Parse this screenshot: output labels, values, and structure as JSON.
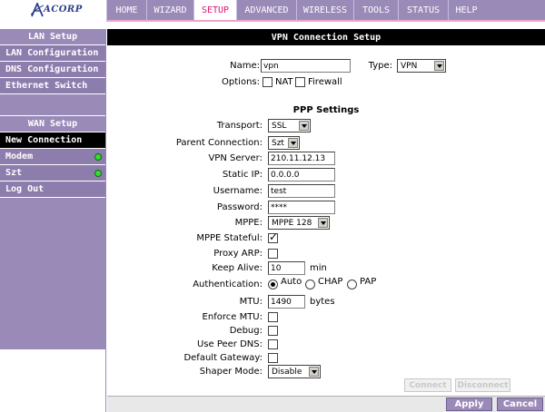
{
  "brand": {
    "logo_text": "ACORP",
    "colors": {
      "nav": "#9a8ab8",
      "accent": "#e1136e",
      "online": "#33dd33"
    }
  },
  "nav": {
    "tabs": [
      {
        "label": "HOME"
      },
      {
        "label": "WIZARD"
      },
      {
        "label": "SETUP"
      },
      {
        "label": "ADVANCED"
      },
      {
        "label": "WIRELESS"
      },
      {
        "label": "TOOLS"
      },
      {
        "label": "STATUS"
      },
      {
        "label": "HELP"
      }
    ]
  },
  "sidebar": {
    "lan_header": "LAN Setup",
    "lan_items": [
      {
        "label": "LAN Configuration"
      },
      {
        "label": "DNS Configuration"
      },
      {
        "label": "Ethernet Switch"
      }
    ],
    "wan_header": "WAN Setup",
    "wan_items": [
      {
        "label": "New Connection"
      },
      {
        "label": "Modem"
      },
      {
        "label": "Szt"
      },
      {
        "label": "Log Out"
      }
    ]
  },
  "page": {
    "title": "VPN Connection Setup",
    "name_label": "Name:",
    "name_value": "vpn",
    "type_label": "Type:",
    "type_value": "VPN",
    "options_label": "Options:",
    "nat_label": "NAT",
    "firewall_label": "Firewall",
    "ppp_header": "PPP Settings",
    "transport_label": "Transport:",
    "transport_value": "SSL",
    "parent_label": "Parent Connection:",
    "parent_value": "Szt",
    "server_label": "VPN Server:",
    "server_value": "210.11.12.13",
    "staticip_label": "Static IP:",
    "staticip_value": "0.0.0.0",
    "username_label": "Username:",
    "username_value": "test",
    "password_label": "Password:",
    "password_value": "****",
    "mppe_label": "MPPE:",
    "mppe_value": "MPPE 128",
    "mppe_stateful_label": "MPPE Stateful:",
    "proxy_arp_label": "Proxy ARP:",
    "keepalive_label": "Keep Alive:",
    "keepalive_value": "10",
    "keepalive_unit": "min",
    "auth_label": "Authentication:",
    "auth_auto": "Auto",
    "auth_chap": "CHAP",
    "auth_pap": "PAP",
    "mtu_label": "MTU:",
    "mtu_value": "1490",
    "mtu_unit": "bytes",
    "enforce_mtu_label": "Enforce MTU:",
    "debug_label": "Debug:",
    "peer_dns_label": "Use Peer DNS:",
    "default_gw_label": "Default Gateway:",
    "shaper_label": "Shaper Mode:",
    "shaper_value": "Disable",
    "connect_label": "Connect",
    "disconnect_label": "Disconnect",
    "apply_label": "Apply",
    "cancel_label": "Cancel"
  }
}
